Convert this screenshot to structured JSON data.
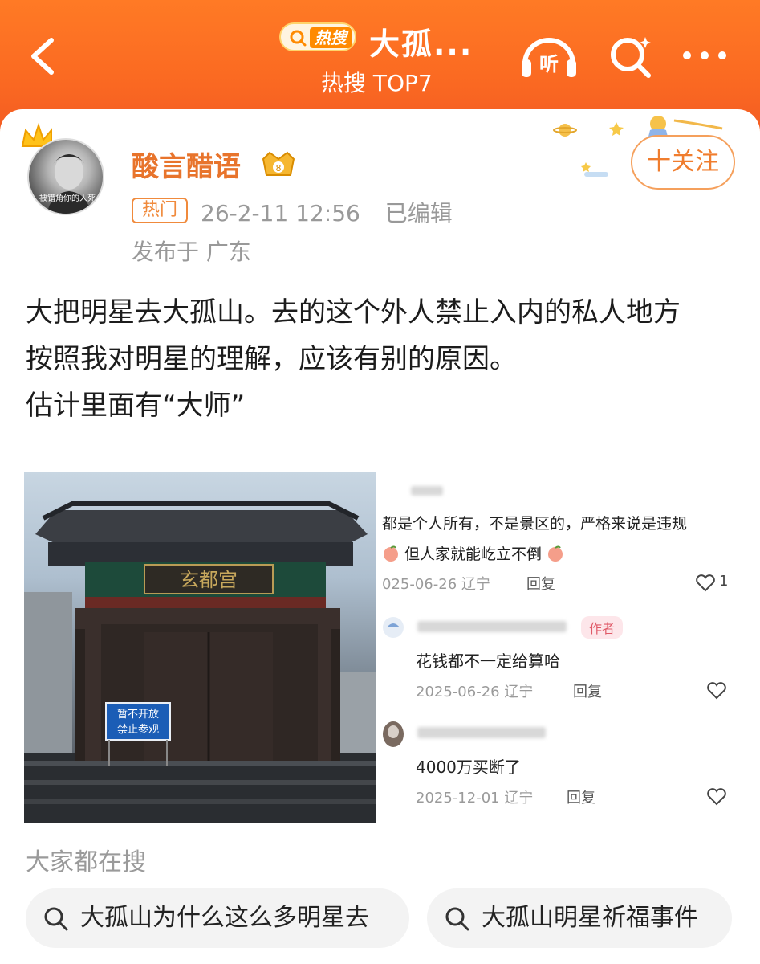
{
  "header": {
    "hot_search_badge": "热搜",
    "title": "大孤...",
    "subtitle": "热搜 TOP7",
    "listen_label": "听",
    "accent": "#fb6a22"
  },
  "post": {
    "author": "酸言醋语",
    "avatar_caption": "被错角你的人死",
    "hot_tag": "热门",
    "datetime": "26-2-11 12:56",
    "edited": "已编辑",
    "location": "发布于 广东",
    "follow": "十关注",
    "lines": [
      "大把明星去大孤山。去的这个外人禁止入内的私人地方",
      "按照我对明星的理解，应该有别的原因。",
      "估计里面有“大师”"
    ]
  },
  "photo": {
    "plaque": "玄都宫",
    "sign_line1": "暂不开放",
    "sign_line2": "禁止参观"
  },
  "comments": {
    "c1_partial_name": "",
    "c1_line1": "都是个人所有，不是景区的，严格来说是违规",
    "c1_line2": "但人家就能屹立不倒",
    "c1_date": "025-06-26 辽宁",
    "c1_reply": "回复",
    "c1_likes": "1",
    "c2_tag": "作者",
    "c2_text": "花钱都不一定给算哈",
    "c2_date": "2025-06-26 辽宁",
    "c2_reply": "回复",
    "c3_text": "4000万买断了",
    "c3_date": "2025-12-01 辽宁",
    "c3_reply": "回复"
  },
  "bottom": {
    "heading": "大家都在搜",
    "chip1": "大孤山为什么这么多明星去",
    "chip2": "大孤山明星祈福事件"
  }
}
